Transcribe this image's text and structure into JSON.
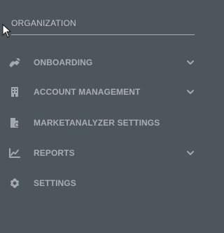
{
  "sidebar": {
    "section_title": "ORGANIZATION",
    "items": [
      {
        "label": "ONBOARDING",
        "icon": "handshake-icon",
        "expandable": true
      },
      {
        "label": "ACCOUNT MANAGEMENT",
        "icon": "building-icon",
        "expandable": true
      },
      {
        "label": "MARKETANALYZER SETTINGS",
        "icon": "file-gear-icon",
        "expandable": false
      },
      {
        "label": "REPORTS",
        "icon": "chart-line-icon",
        "expandable": true
      },
      {
        "label": "SETTINGS",
        "icon": "gear-icon",
        "expandable": false
      }
    ]
  },
  "colors": {
    "background": "#4d555d",
    "text": "#a9aeb3",
    "header_text": "#c2c6ca",
    "divider": "#b7bcc1"
  }
}
